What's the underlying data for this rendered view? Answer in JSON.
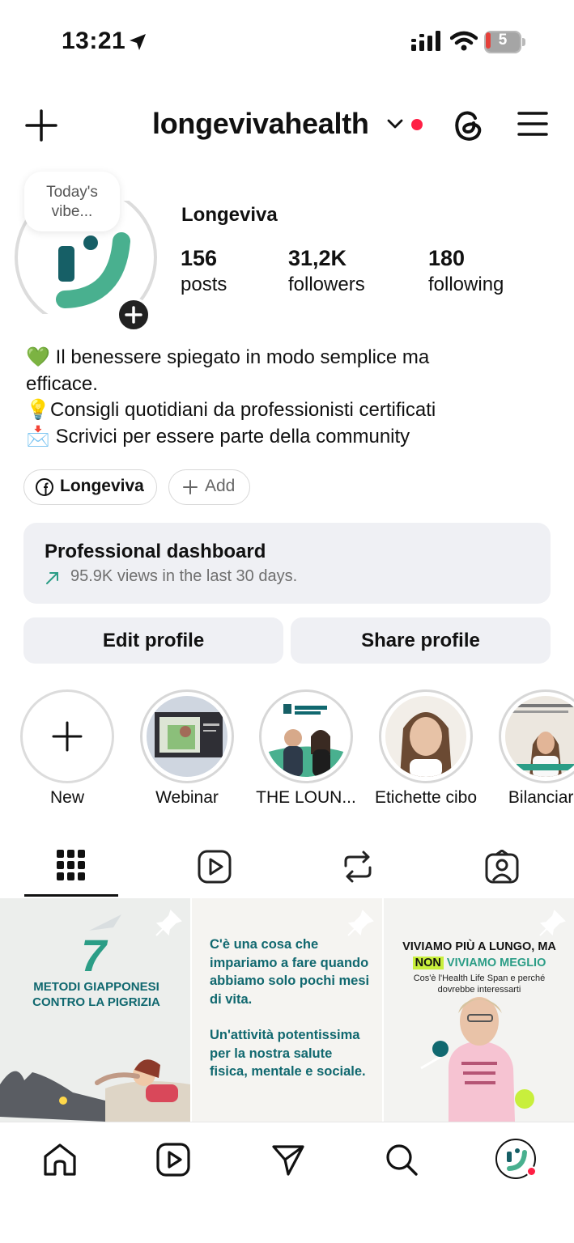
{
  "status": {
    "time": "13:21",
    "battery": "5"
  },
  "header": {
    "username": "longevivahealth"
  },
  "profile": {
    "note_line1": "Today's",
    "note_line2": "vibe...",
    "display_name": "Longeviva",
    "stats": [
      {
        "num": "156",
        "label": "posts"
      },
      {
        "num": "31,2K",
        "label": "followers"
      },
      {
        "num": "180",
        "label": "following"
      }
    ],
    "bio": [
      {
        "emoji": "💚",
        "text": "Il benessere spiegato in modo semplice ma"
      },
      {
        "emoji": "",
        "text": "efficace."
      },
      {
        "emoji": "💡",
        "text": "Consigli quotidiani da professionisti certificati"
      },
      {
        "emoji": "📩",
        "text": "Scrivici per essere parte della community"
      }
    ],
    "link_chip": "Longeviva",
    "add_chip": "Add"
  },
  "dashboard": {
    "title": "Professional dashboard",
    "subtitle": "95.9K views in the last 30 days."
  },
  "buttons": {
    "edit": "Edit profile",
    "share": "Share profile"
  },
  "highlights": [
    {
      "label": "New"
    },
    {
      "label": "Webinar"
    },
    {
      "label": "THE LOUN..."
    },
    {
      "label": "Etichette cibo"
    },
    {
      "label": "Bilanciare"
    }
  ],
  "tabs": [
    "grid-icon",
    "reels-icon",
    "reposts-icon",
    "tagged-icon"
  ],
  "posts": {
    "p1": {
      "number": "7",
      "text": "METODI GIAPPONESI CONTRO LA PIGRIZIA"
    },
    "p2": {
      "para1": "C'è una cosa che impariamo a fare quando abbiamo solo pochi mesi di vita.",
      "para2": "Un'attività potentissima per la nostra salute fisica, mentale e sociale."
    },
    "p3": {
      "title_a": "VIVIAMO PIÙ A LUNGO, MA",
      "title_non": "NON",
      "title_b": "VIVIAMO MEGLIO",
      "sub": "Cos'è l'Health Life Span e perché dovrebbe interessarti"
    }
  },
  "colors": {
    "accent": "#2b9d86",
    "dark_green": "#10686f",
    "notification": "#ff1f44"
  }
}
